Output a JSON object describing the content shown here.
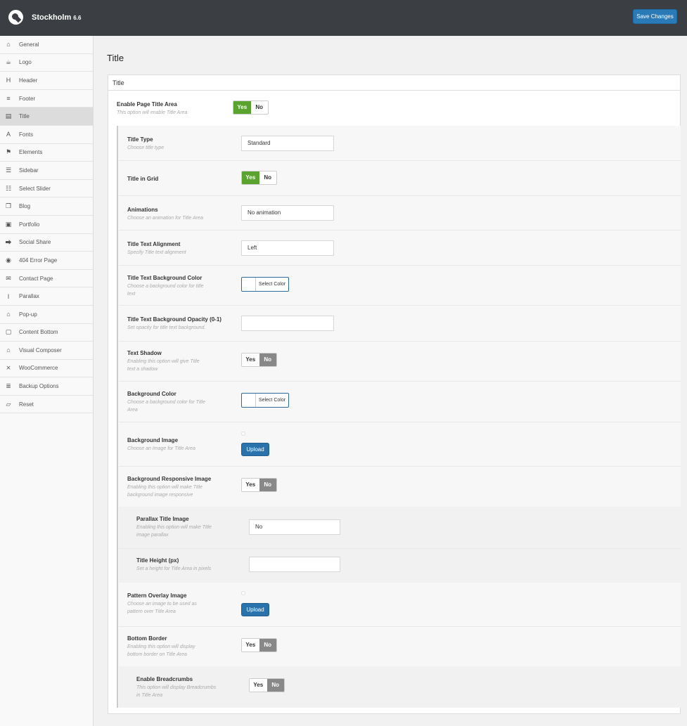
{
  "header": {
    "brand": "Stockholm",
    "version": "6.6",
    "save_label": "Save Changes",
    "colors": {
      "bar": "#3b3e42",
      "save": "#2a7ab8"
    }
  },
  "sidebar": {
    "items": [
      {
        "label": "General",
        "icon": "bank-icon"
      },
      {
        "label": "Logo",
        "icon": "coffee-icon"
      },
      {
        "label": "Header",
        "icon": "header-icon"
      },
      {
        "label": "Footer",
        "icon": "footer-icon"
      },
      {
        "label": "Title",
        "icon": "title-icon"
      },
      {
        "label": "Fonts",
        "icon": "font-icon"
      },
      {
        "label": "Elements",
        "icon": "flag-icon"
      },
      {
        "label": "Sidebar",
        "icon": "list-icon"
      },
      {
        "label": "Select Slider",
        "icon": "sliders-icon"
      },
      {
        "label": "Blog",
        "icon": "blog-icon"
      },
      {
        "label": "Portfolio",
        "icon": "portfolio-icon"
      },
      {
        "label": "Social Share",
        "icon": "share-icon"
      },
      {
        "label": "404 Error Page",
        "icon": "error-icon"
      },
      {
        "label": "Contact Page",
        "icon": "envelope-icon"
      },
      {
        "label": "Parallax",
        "icon": "parallax-icon"
      },
      {
        "label": "Pop-up",
        "icon": "bank-icon"
      },
      {
        "label": "Content Bottom",
        "icon": "content-icon"
      },
      {
        "label": "Visual Composer",
        "icon": "bank-icon"
      },
      {
        "label": "WooCommerce",
        "icon": "cart-icon"
      },
      {
        "label": "Backup Options",
        "icon": "database-icon"
      },
      {
        "label": "Reset",
        "icon": "eraser-icon"
      }
    ],
    "active_index": 4
  },
  "main": {
    "page_title": "Title",
    "panel_title": "Title",
    "enable_title": {
      "label": "Enable Page Title Area",
      "desc": "This option will enable Title Area",
      "yes": "Yes",
      "no": "No"
    },
    "title_type": {
      "label": "Title Type",
      "desc": "Choose title type",
      "value": "Standard"
    },
    "title_in_grid": {
      "label": "Title in Grid",
      "yes": "Yes",
      "no": "No"
    },
    "animations": {
      "label": "Animations",
      "desc": "Choose an animation for Title Area",
      "value": "No animation"
    },
    "text_alignment": {
      "label": "Title Text Alignment",
      "desc": "Specify Title text alignment",
      "value": "Left"
    },
    "text_bg_color": {
      "label": "Title Text Background Color",
      "desc1": "Choose a background color for title",
      "desc2": "text",
      "button": "Select Color"
    },
    "text_bg_opacity": {
      "label": "Title Text Background Opacity (0-1)",
      "desc": "Set opacity for title text background.",
      "value": ""
    },
    "text_shadow": {
      "label": "Text Shadow",
      "desc1": "Enabling this option will give Title",
      "desc2": "text a shadow",
      "yes": "Yes",
      "no": "No"
    },
    "bg_color": {
      "label": "Background Color",
      "desc1": "Choose a background color for Title",
      "desc2": "Area",
      "button": "Select Color"
    },
    "bg_image": {
      "label": "Background Image",
      "desc": "Choose an Image for Title Area",
      "button": "Upload"
    },
    "bg_responsive": {
      "label": "Background Responsive Image",
      "desc1": "Enabling this option will make Title",
      "desc2": "background image responsive",
      "yes": "Yes",
      "no": "No"
    },
    "parallax_image": {
      "label": "Parallax Title Image",
      "desc1": "Enabling this option will make Title",
      "desc2": "image parallax",
      "value": "No"
    },
    "title_height": {
      "label": "Title Height (px)",
      "desc": "Set a height for Title Area in pixels",
      "value": ""
    },
    "pattern_overlay": {
      "label": "Pattern Overlay Image",
      "desc1": "Choose an image to be used as",
      "desc2": "pattern over Title Area",
      "button": "Upload"
    },
    "bottom_border": {
      "label": "Bottom Border",
      "desc1": "Enabling this option will display",
      "desc2": "bottom border on Title Area",
      "yes": "Yes",
      "no": "No"
    },
    "breadcrumbs": {
      "label": "Enable Breadcrumbs",
      "desc1": "This option will display Breadcrumbs",
      "desc2": "in Title Area",
      "yes": "Yes",
      "no": "No"
    }
  }
}
